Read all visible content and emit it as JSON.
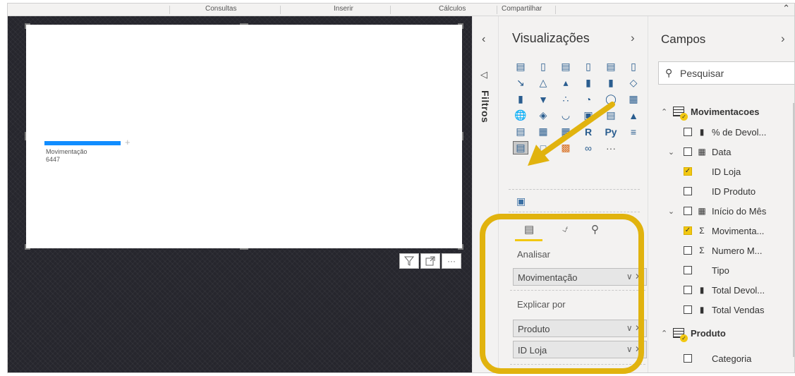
{
  "ribbon": {
    "tabs": [
      "Consultas",
      "Inserir",
      "Cálculos",
      "Compartilhar"
    ],
    "collapse_icon": "chevron-up-icon"
  },
  "visual": {
    "decomposition_tree": {
      "label": "Movimentação",
      "value": "6447",
      "expand_icon": "plus-icon",
      "bar_color": "#118dff"
    },
    "header_icons": [
      "filter-icon",
      "focus-mode-icon",
      "more-options-icon"
    ]
  },
  "filters": {
    "label": "Filtros",
    "collapse_icon": "chevron-left-icon",
    "filter_icon": "funnel-icon"
  },
  "visualizations": {
    "title": "Visualizações",
    "expand_icon": "chevron-right-icon",
    "more": "···",
    "r_visual": "R",
    "python_visual": "Py",
    "selected_visual": "decomposition-tree-icon",
    "well_tabs": [
      "fields-tab-icon",
      "format-tab-icon",
      "analytics-tab-icon"
    ],
    "analyze": {
      "label": "Analisar",
      "fields": [
        {
          "name": "Movimentação"
        }
      ]
    },
    "explain_by": {
      "label": "Explicar por",
      "fields": [
        {
          "name": "Produto"
        },
        {
          "name": "ID Loja"
        }
      ]
    }
  },
  "fields": {
    "title": "Campos",
    "expand_icon": "chevron-right-icon",
    "search": {
      "placeholder": "Pesquisar"
    },
    "tables": [
      {
        "name": "Movimentacoes",
        "expanded": true,
        "items": [
          {
            "name": "% de Devol...",
            "checked": false,
            "icon": "measure-icon",
            "expandable": false
          },
          {
            "name": "Data",
            "checked": false,
            "icon": "calendar-icon",
            "expandable": true
          },
          {
            "name": "ID Loja",
            "checked": true,
            "icon": "",
            "expandable": false
          },
          {
            "name": "ID Produto",
            "checked": false,
            "icon": "",
            "expandable": false
          },
          {
            "name": "Início do Mês",
            "checked": false,
            "icon": "calendar-icon",
            "expandable": true
          },
          {
            "name": "Movimenta...",
            "checked": true,
            "icon": "sigma-icon",
            "expandable": false
          },
          {
            "name": "Numero M...",
            "checked": false,
            "icon": "sigma-icon",
            "expandable": false
          },
          {
            "name": "Tipo",
            "checked": false,
            "icon": "",
            "expandable": false
          },
          {
            "name": "Total Devol...",
            "checked": false,
            "icon": "measure-icon",
            "expandable": false
          },
          {
            "name": "Total Vendas",
            "checked": false,
            "icon": "measure-icon",
            "expandable": false
          }
        ]
      },
      {
        "name": "Produto",
        "expanded": true,
        "items": [
          {
            "name": "Categoria",
            "checked": false,
            "icon": "",
            "expandable": false
          }
        ]
      }
    ]
  },
  "annotations": {
    "highlight_color": "#e1b30e",
    "arrow_color": "#e1b30e"
  }
}
